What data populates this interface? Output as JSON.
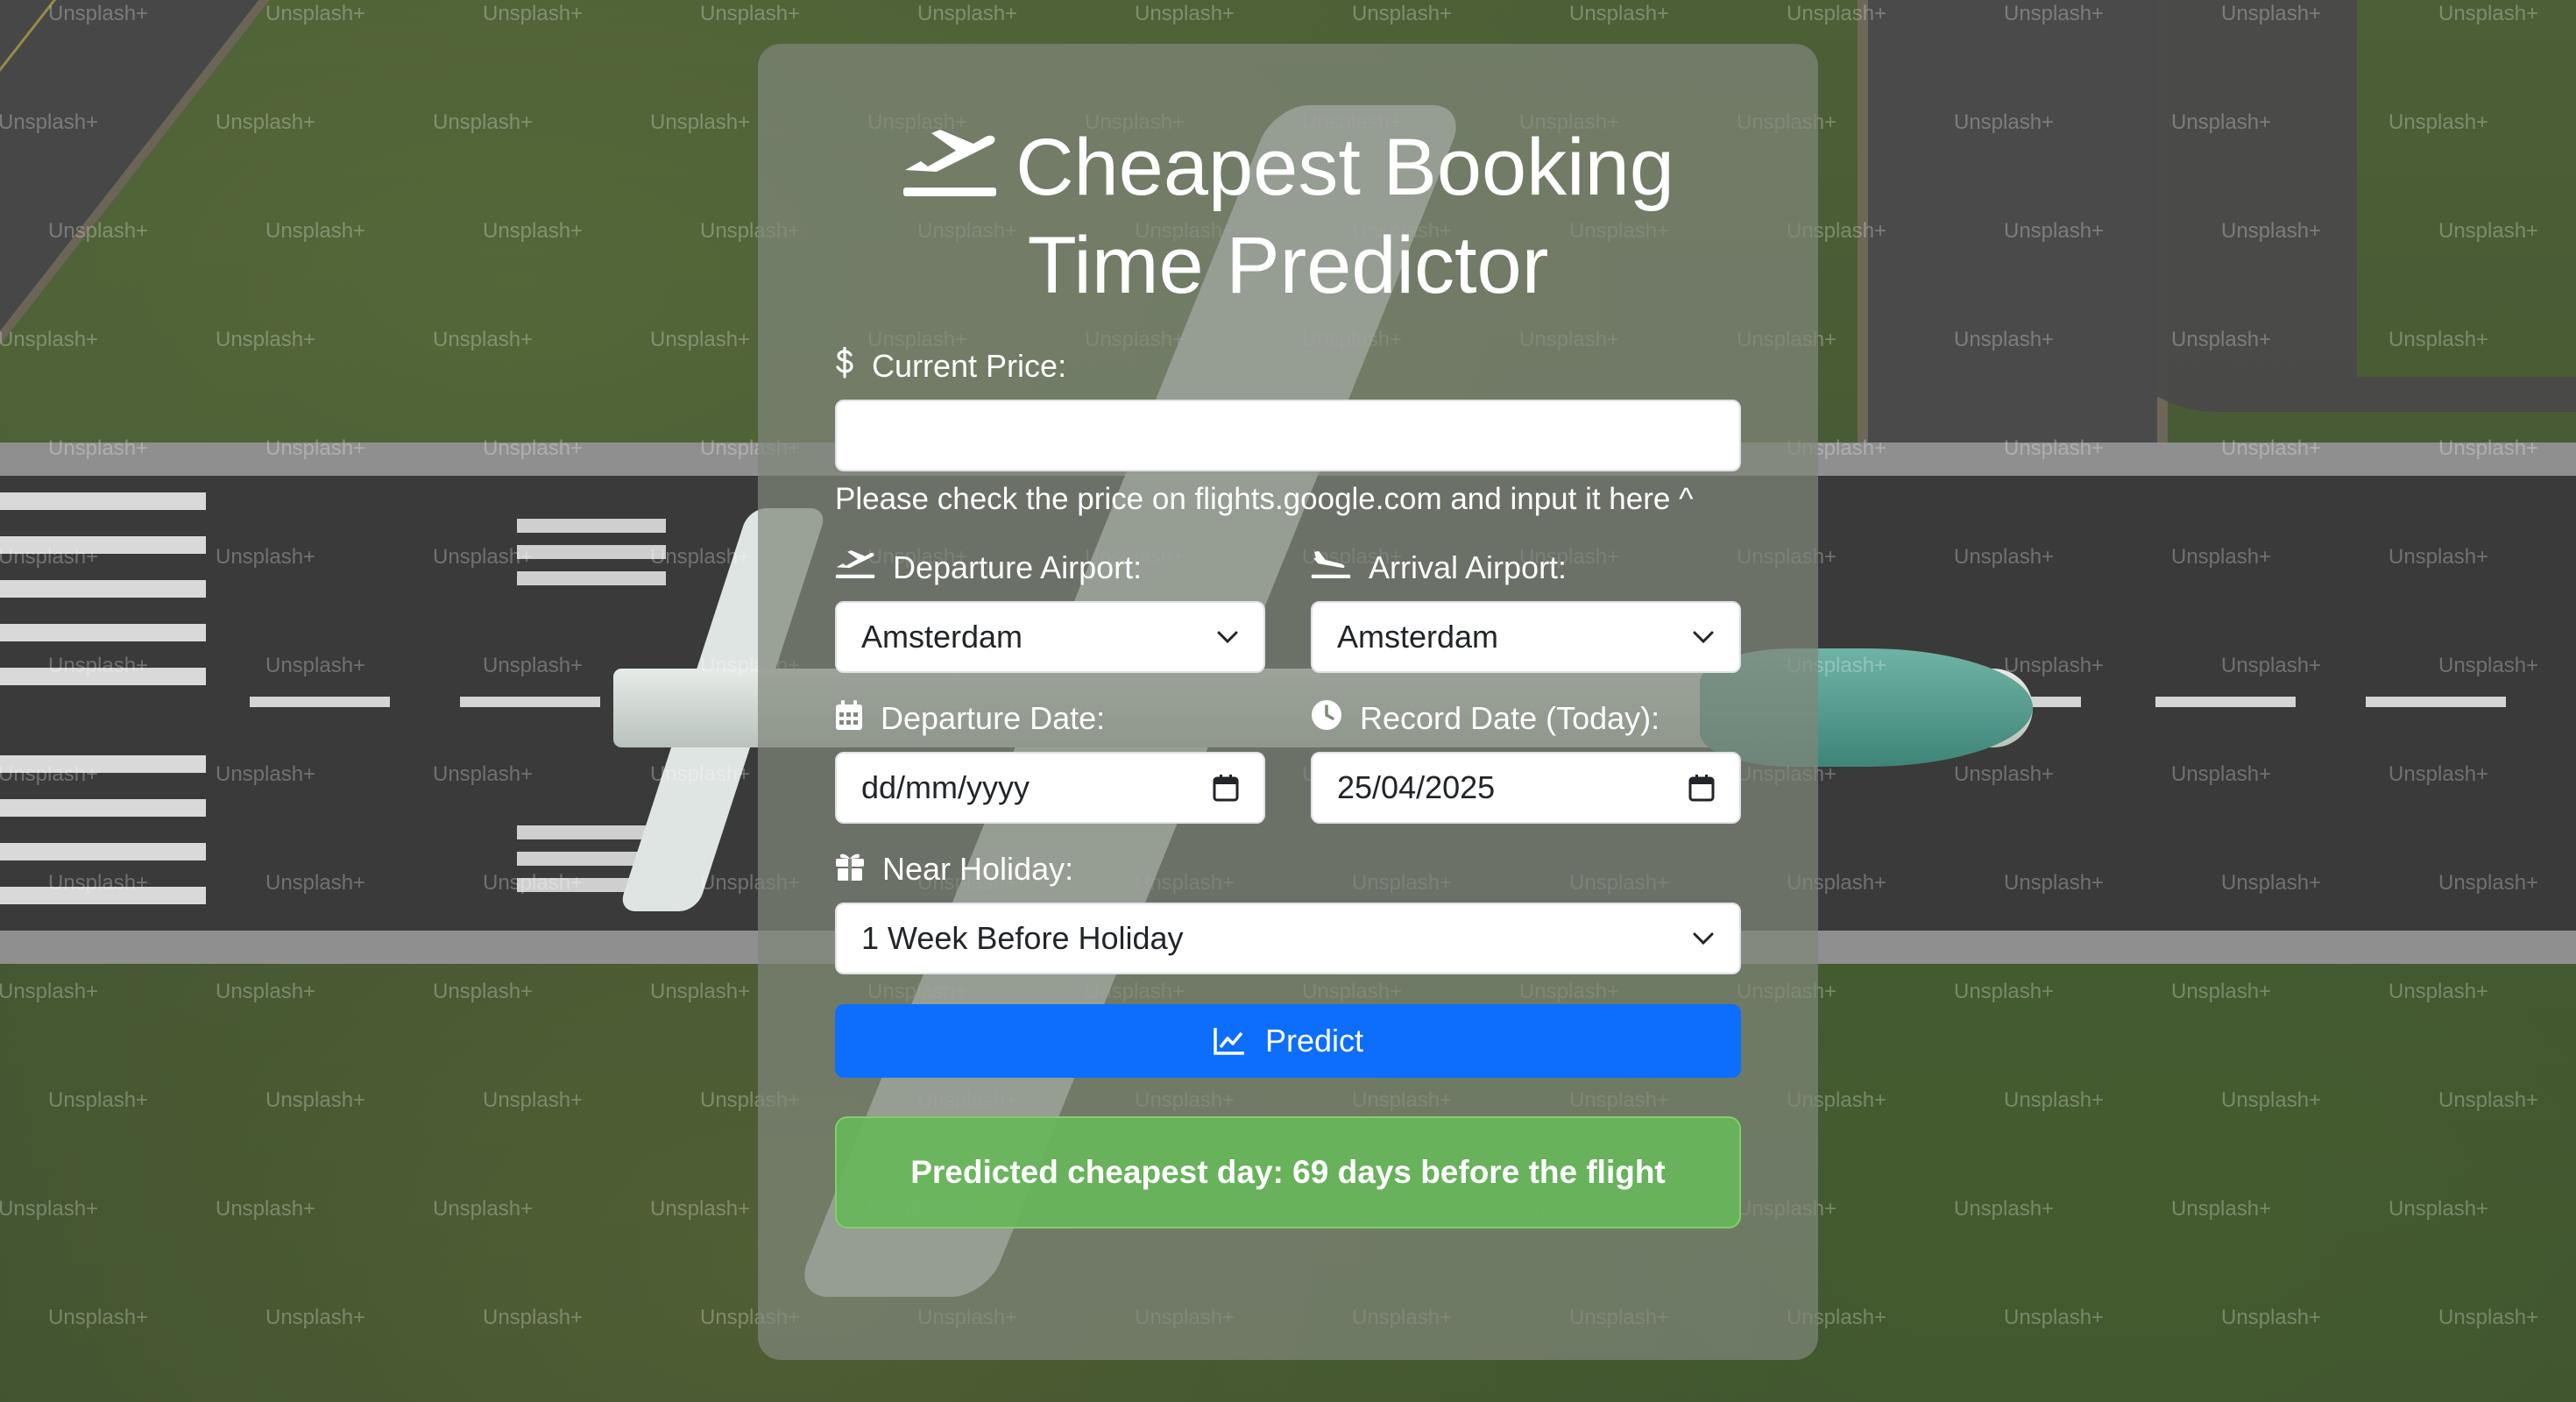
{
  "page": {
    "title": "Cheapest Booking Time Predictor",
    "title_line1": "Cheapest Booking",
    "title_line2": "Time Predictor",
    "title_icon": "plane-departure-icon",
    "watermark": "Unsplash+"
  },
  "form": {
    "price": {
      "label": "Current Price:",
      "icon": "dollar-icon",
      "value": "",
      "hint": "Please check the price on flights.google.com and input it here ^"
    },
    "departure_airport": {
      "label": "Departure Airport:",
      "icon": "plane-departure-icon",
      "value": "Amsterdam"
    },
    "arrival_airport": {
      "label": "Arrival Airport:",
      "icon": "plane-arrival-icon",
      "value": "Amsterdam"
    },
    "departure_date": {
      "label": "Departure Date:",
      "icon": "calendar-icon",
      "value": "dd/mm/yyyy"
    },
    "record_date": {
      "label": "Record Date (Today):",
      "icon": "clock-icon",
      "value": "25/04/2025"
    },
    "near_holiday": {
      "label": "Near Holiday:",
      "icon": "gift-icon",
      "value": "1 Week Before Holiday"
    },
    "predict_button": {
      "label": "Predict",
      "icon": "chart-line-icon"
    }
  },
  "result": {
    "text": "Predicted cheapest day: 69 days before the flight"
  },
  "colors": {
    "primary": "#0d6efd",
    "success": "#66b85a",
    "card": "rgba(128,135,122,0.72)"
  }
}
